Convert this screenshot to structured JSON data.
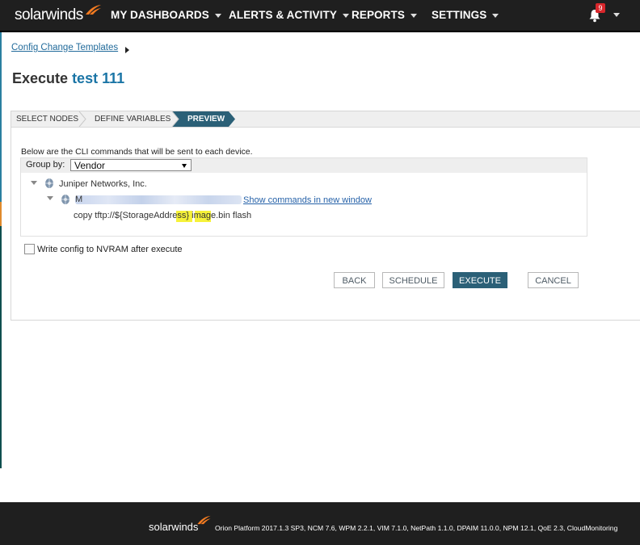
{
  "nav": {
    "logo_text": "solarwinds",
    "items": [
      {
        "label": "MY DASHBOARDS"
      },
      {
        "label": "ALERTS & ACTIVITY"
      },
      {
        "label": "REPORTS"
      },
      {
        "label": "SETTINGS"
      }
    ],
    "notification_count": "9"
  },
  "breadcrumb": {
    "link": "Config Change Templates"
  },
  "page": {
    "title_prefix": "Execute",
    "title_name": "test 111"
  },
  "wizard": {
    "steps": [
      {
        "label": "SELECT NODES",
        "active": false
      },
      {
        "label": "DEFINE VARIABLES",
        "active": false
      },
      {
        "label": "PREVIEW",
        "active": true
      }
    ]
  },
  "preview": {
    "description": "Below are the CLI commands that will be sent to each device.",
    "group_by_label": "Group by:",
    "group_by_value": "Vendor",
    "vendor_name": "Juniper Networks, Inc.",
    "node_initial": "M",
    "show_commands_link": "Show commands in new window",
    "command": "copy tftp://${StorageAddress} image.bin flash"
  },
  "options": {
    "nvram_label": "Write config to NVRAM after execute",
    "nvram_checked": false
  },
  "buttons": {
    "back": "BACK",
    "schedule": "SCHEDULE",
    "execute": "EXECUTE",
    "cancel": "CANCEL"
  },
  "footer": {
    "logo_text": "solarwinds",
    "platform_text": "Orion Platform 2017.1.3 SP3, NCM 7.6, WPM 2.2.1, VIM 7.1.0, NetPath 1.1.0, DPAIM 11.0.0, NPM 12.1, QoE 2.3, CloudMonitoring"
  },
  "colors": {
    "accent": "#1b75a6",
    "active_step": "#2b6077",
    "highlight": "#f6f23a",
    "badge": "#d8262b"
  }
}
